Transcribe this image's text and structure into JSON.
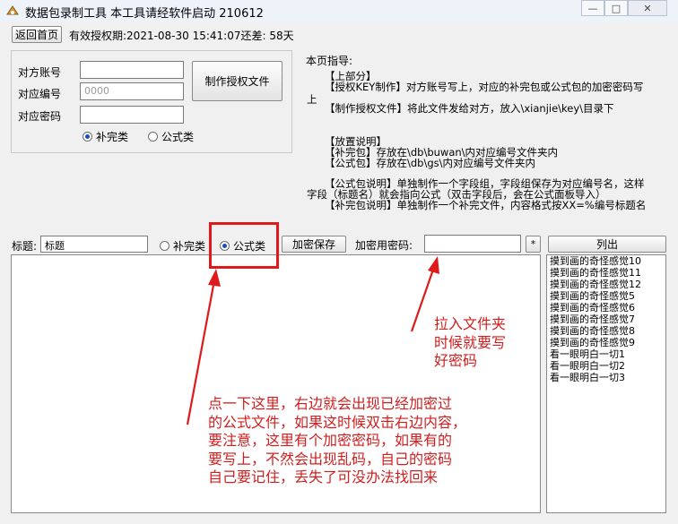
{
  "window": {
    "title": "数据包录制工具   本工具请经软件启动 210612",
    "min_glyph": "—",
    "max_glyph": "□",
    "close_glyph": "✕"
  },
  "top": {
    "back_button": "返回首页",
    "license_text": "有效授权期:2021-08-30  15:41:07还差: 58天"
  },
  "license_form": {
    "account_label": "对方账号",
    "account_value": "",
    "code_label": "对应编号",
    "code_placeholder": "0000",
    "password_label": "对应密码",
    "password_value": "",
    "make_button": "制作授权文件",
    "radio_patch": "补完类",
    "radio_formula": "公式类",
    "selected": "补完类"
  },
  "guide": {
    "title": "本页指导:",
    "lines": [
      "【上部分】",
      "【授权KEY制作】对方账号写上，对应的补完包或公式包的加密密码写",
      "上",
      "【制作授权文件】将此文件发给对方，放入\\xianjie\\key\\目录下",
      "【放置说明】",
      "【补完包】存放在\\db\\buwan\\内对应编号文件夹内",
      "【公式包】存放在\\db\\gs\\内对应编号文件夹内",
      "【公式包说明】单独制作一个字段组，字段组保存为对应编号名，这样",
      "字段（标题名）就会指向公式（双击字段后，会在公式面板导入）",
      "【补完包说明】单独制作一个补完文件，内容格式按XX=%编号标题名"
    ]
  },
  "toolbar": {
    "title_label": "标题:",
    "title_value": "标题",
    "radio_patch": "补完类",
    "radio_formula": "公式类",
    "selected": "公式类",
    "save_button": "加密保存",
    "password_label": "加密用密码:",
    "password_value": "",
    "star_button": "*",
    "list_button": "列出"
  },
  "files": [
    "摸到画的奇怪感觉10",
    "摸到画的奇怪感觉11",
    "摸到画的奇怪感觉12",
    "摸到画的奇怪感觉5",
    "摸到画的奇怪感觉6",
    "摸到画的奇怪感觉7",
    "摸到画的奇怪感觉8",
    "摸到画的奇怪感觉9",
    "看一眼明白一切1",
    "看一眼明白一切2",
    "看一眼明白一切3"
  ],
  "annotations": {
    "right_note": [
      "拉入文件夹",
      "时候就要写",
      "好密码"
    ],
    "left_note": [
      "点一下这里，右边就会出现已经加密过",
      "的公式文件，如果这时候双击右边内容，",
      "要注意，这里有个加密密码，如果有的",
      "要写上，不然会出现乱码，自己的密码",
      "自己要记住，丢失了可没办法找回来"
    ],
    "color": "#d21e1e"
  }
}
